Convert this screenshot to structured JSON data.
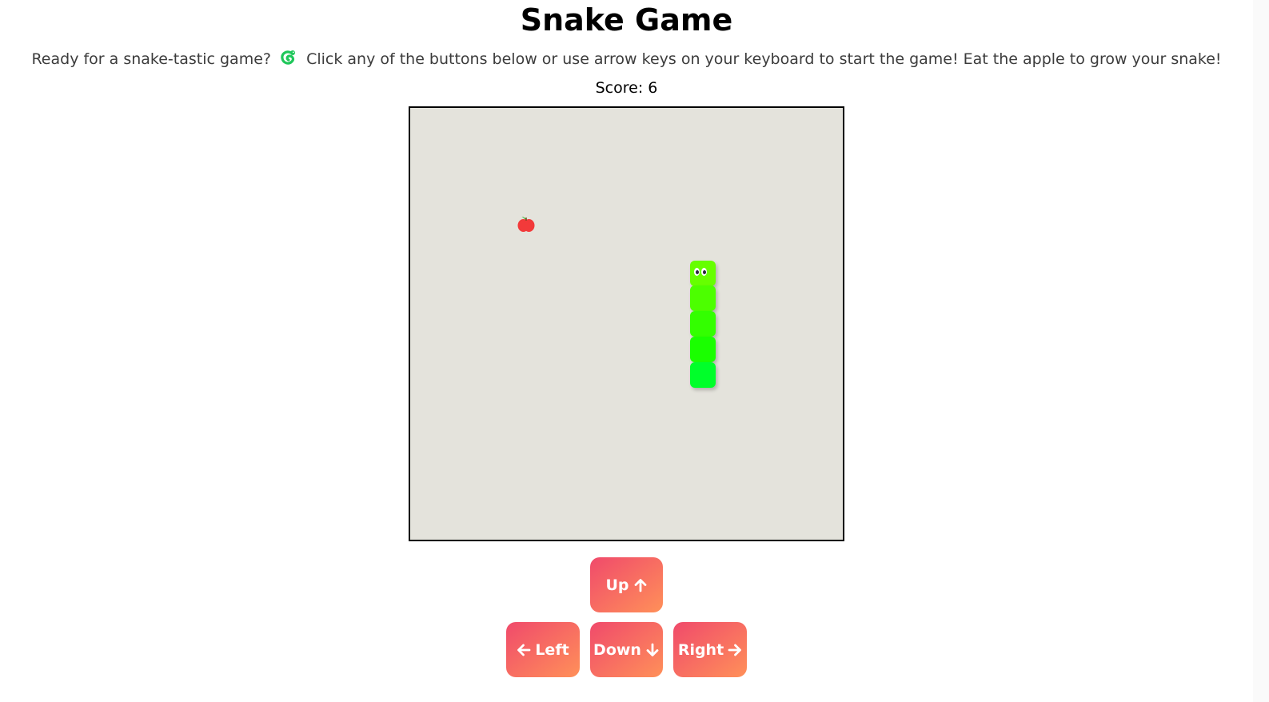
{
  "header": {
    "title": "Snake Game",
    "intro_before": "Ready for a snake-tastic game?",
    "intro_icon": "snake-emoji-icon",
    "intro_after": "Click any of the buttons below or use arrow keys on your keyboard to start the game! Eat the apple to grow your snake!"
  },
  "score": {
    "text": "Score: 6"
  },
  "board": {
    "background": "#e4e3dc",
    "apple_icon": "apple-icon",
    "snake_segments": 5,
    "snake_colors": [
      "#66ff00",
      "#4cff00",
      "#33ff00",
      "#1aff00",
      "#00ff2a"
    ]
  },
  "controls": {
    "up_label": "Up",
    "left_label": "Left",
    "down_label": "Down",
    "right_label": "Right",
    "gradient": [
      "#f04a6b",
      "#ff9059"
    ]
  }
}
